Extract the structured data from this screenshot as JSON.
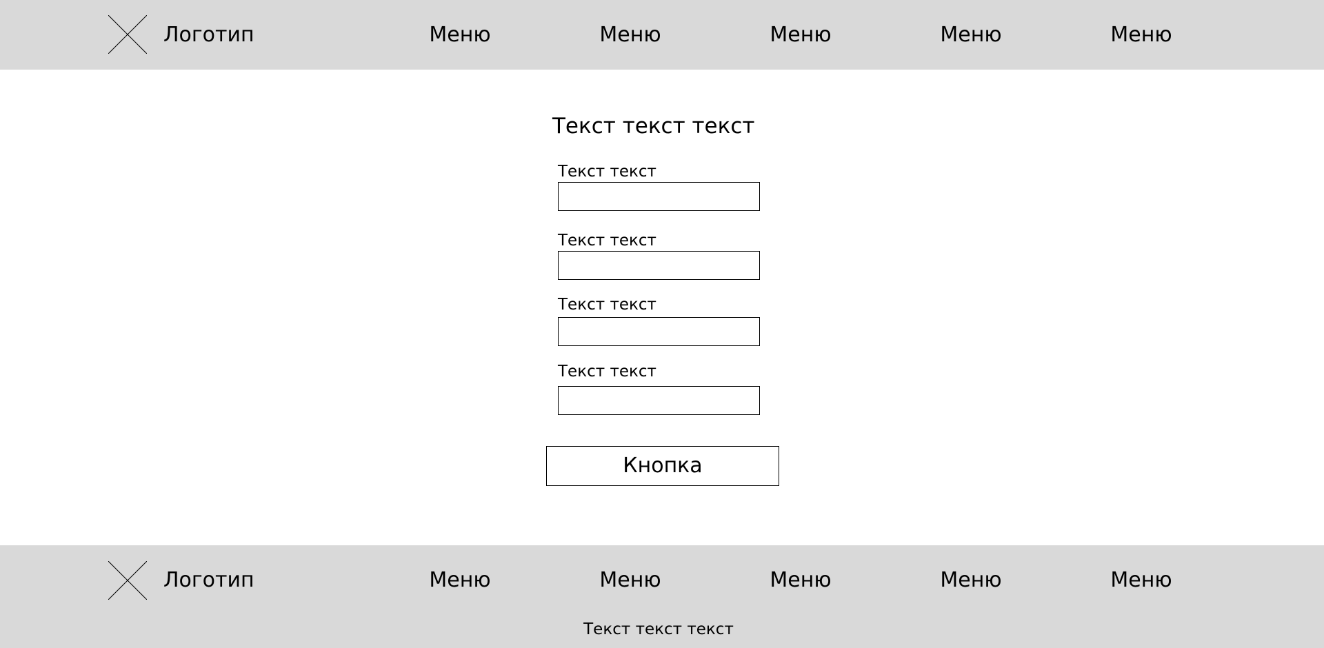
{
  "header": {
    "logo_icon": "placeholder-x-icon",
    "logo_text": "Логотип",
    "menu": [
      {
        "label": "Меню"
      },
      {
        "label": "Меню"
      },
      {
        "label": "Меню"
      },
      {
        "label": "Меню"
      },
      {
        "label": "Меню"
      }
    ]
  },
  "form": {
    "title": "Текст текст текст",
    "fields": [
      {
        "label": "Текст текст",
        "value": "",
        "placeholder": ""
      },
      {
        "label": "Текст текст",
        "value": "",
        "placeholder": ""
      },
      {
        "label": "Текст текст",
        "value": "",
        "placeholder": ""
      },
      {
        "label": "Текст текст",
        "value": "",
        "placeholder": ""
      }
    ],
    "button_label": "Кнопка"
  },
  "footer": {
    "logo_icon": "placeholder-x-icon",
    "logo_text": "Логотип",
    "menu": [
      {
        "label": "Меню"
      },
      {
        "label": "Меню"
      },
      {
        "label": "Меню"
      },
      {
        "label": "Меню"
      },
      {
        "label": "Меню"
      }
    ],
    "text": "Текст текст текст"
  },
  "colors": {
    "bar_background": "#d9d9d9",
    "page_background": "#ffffff",
    "border": "#000000",
    "text": "#000000"
  }
}
